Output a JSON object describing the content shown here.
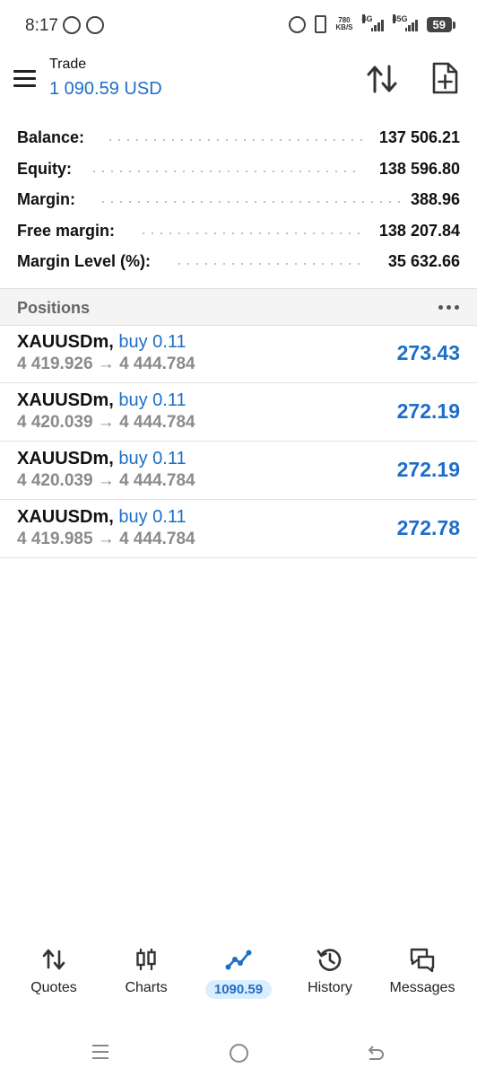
{
  "status_bar": {
    "time": "8:17",
    "net_speed_value": "780",
    "net_speed_unit": "KB/S",
    "signal1": "4G",
    "signal2": "4",
    "signal2_sup": "5G",
    "battery": "59"
  },
  "header": {
    "title": "Trade",
    "amount": "1 090.59 USD"
  },
  "summary": {
    "rows": [
      {
        "label": "Balance:",
        "value": "137 506.21"
      },
      {
        "label": "Equity:",
        "value": "138 596.80"
      },
      {
        "label": "Margin:",
        "value": "388.96"
      },
      {
        "label": "Free margin:",
        "value": "138 207.84"
      },
      {
        "label": "Margin Level (%):",
        "value": "35 632.66"
      }
    ]
  },
  "positions": {
    "title": "Positions",
    "items": [
      {
        "symbol": "XAUUSDm,",
        "side": "buy 0.11",
        "prices": "4 419.926 → 4 444.784",
        "profit": "273.43"
      },
      {
        "symbol": "XAUUSDm,",
        "side": "buy 0.11",
        "prices": "4 420.039 → 4 444.784",
        "profit": "272.19"
      },
      {
        "symbol": "XAUUSDm,",
        "side": "buy 0.11",
        "prices": "4 420.039 → 4 444.784",
        "profit": "272.19"
      },
      {
        "symbol": "XAUUSDm,",
        "side": "buy 0.11",
        "prices": "4 419.985 → 4 444.784",
        "profit": "272.78"
      }
    ]
  },
  "nav": {
    "quotes": "Quotes",
    "charts": "Charts",
    "trade": "1090.59",
    "history": "History",
    "messages": "Messages"
  },
  "colors": {
    "accent": "#1e6ec8",
    "accent_bg": "#dbeeff",
    "muted": "#8a8a8a"
  },
  "icons": {
    "menu": "hamburger-icon",
    "sort": "sort-arrows-icon",
    "new_order": "document-plus-icon",
    "more": "more-dots-icon",
    "quotes": "arrows-updown-icon",
    "charts": "candlestick-icon",
    "trade": "trend-line-icon",
    "history": "history-clock-icon",
    "messages": "chat-bubbles-icon"
  }
}
